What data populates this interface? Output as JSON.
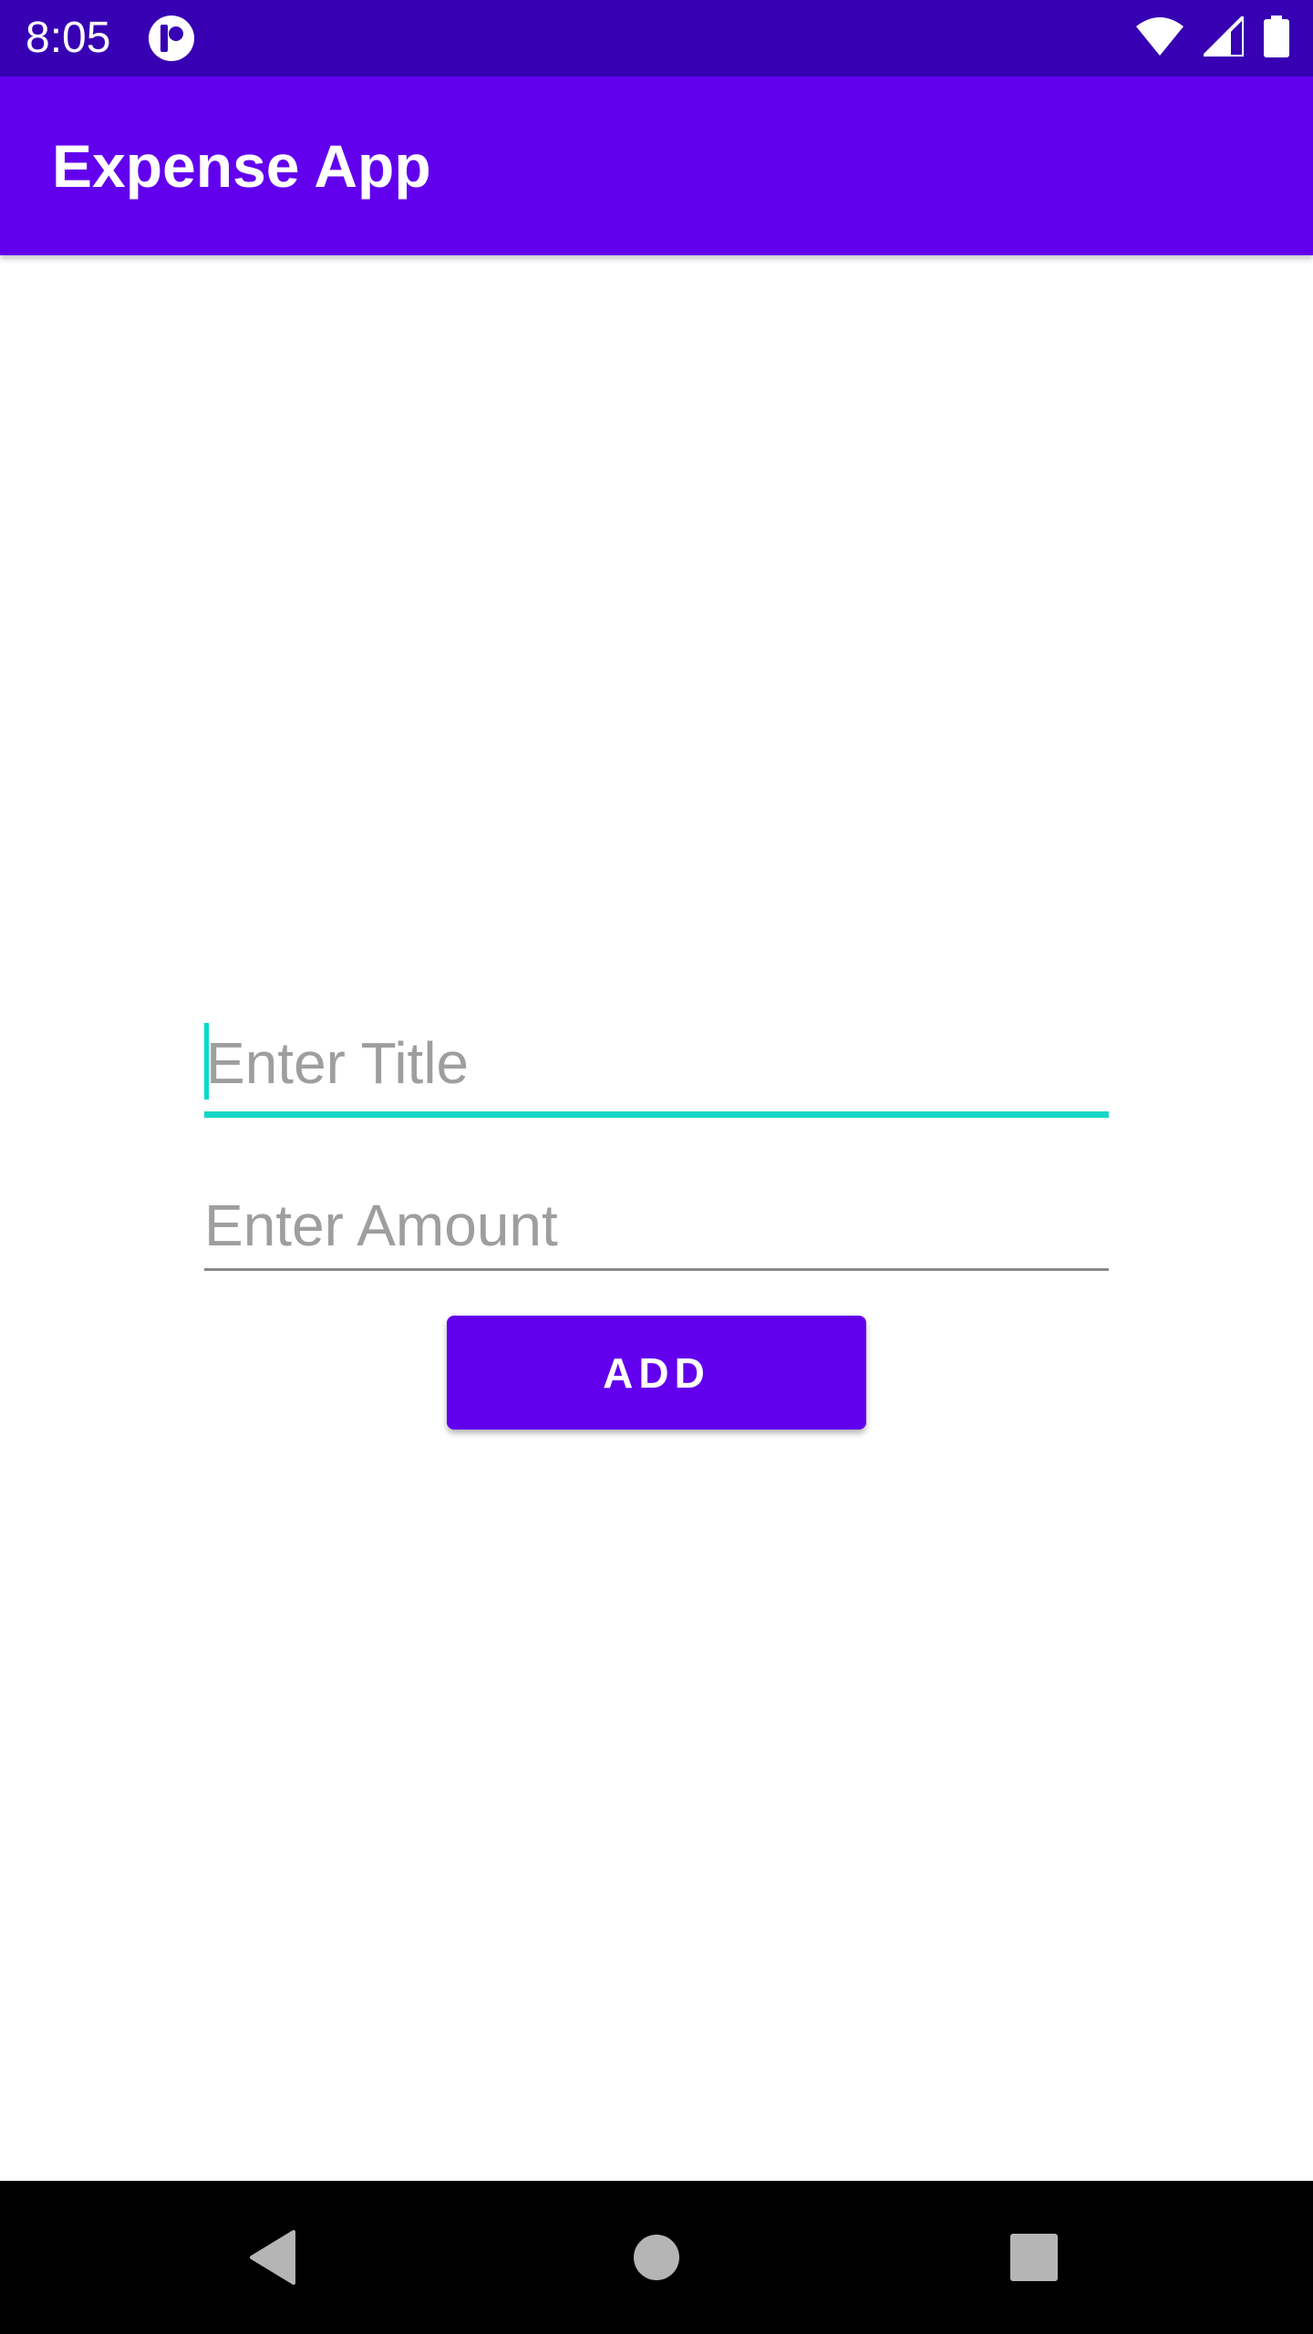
{
  "status_bar": {
    "time": "8:05",
    "icons": [
      "app-notification-icon",
      "wifi-icon",
      "cellular-signal-icon",
      "battery-icon"
    ]
  },
  "app_bar": {
    "title": "Expense App"
  },
  "form": {
    "title_field": {
      "value": "",
      "placeholder": "Enter Title",
      "focused": true
    },
    "amount_field": {
      "value": "",
      "placeholder": "Enter Amount"
    },
    "add_button_label": "ADD"
  },
  "navigation_bar": {
    "buttons": [
      "back-icon",
      "home-icon",
      "recents-icon"
    ]
  },
  "colors": {
    "status_bar": "#3700b3",
    "primary": "#6200ee",
    "accent": "#03dac5",
    "placeholder": "#9e9e9e"
  }
}
